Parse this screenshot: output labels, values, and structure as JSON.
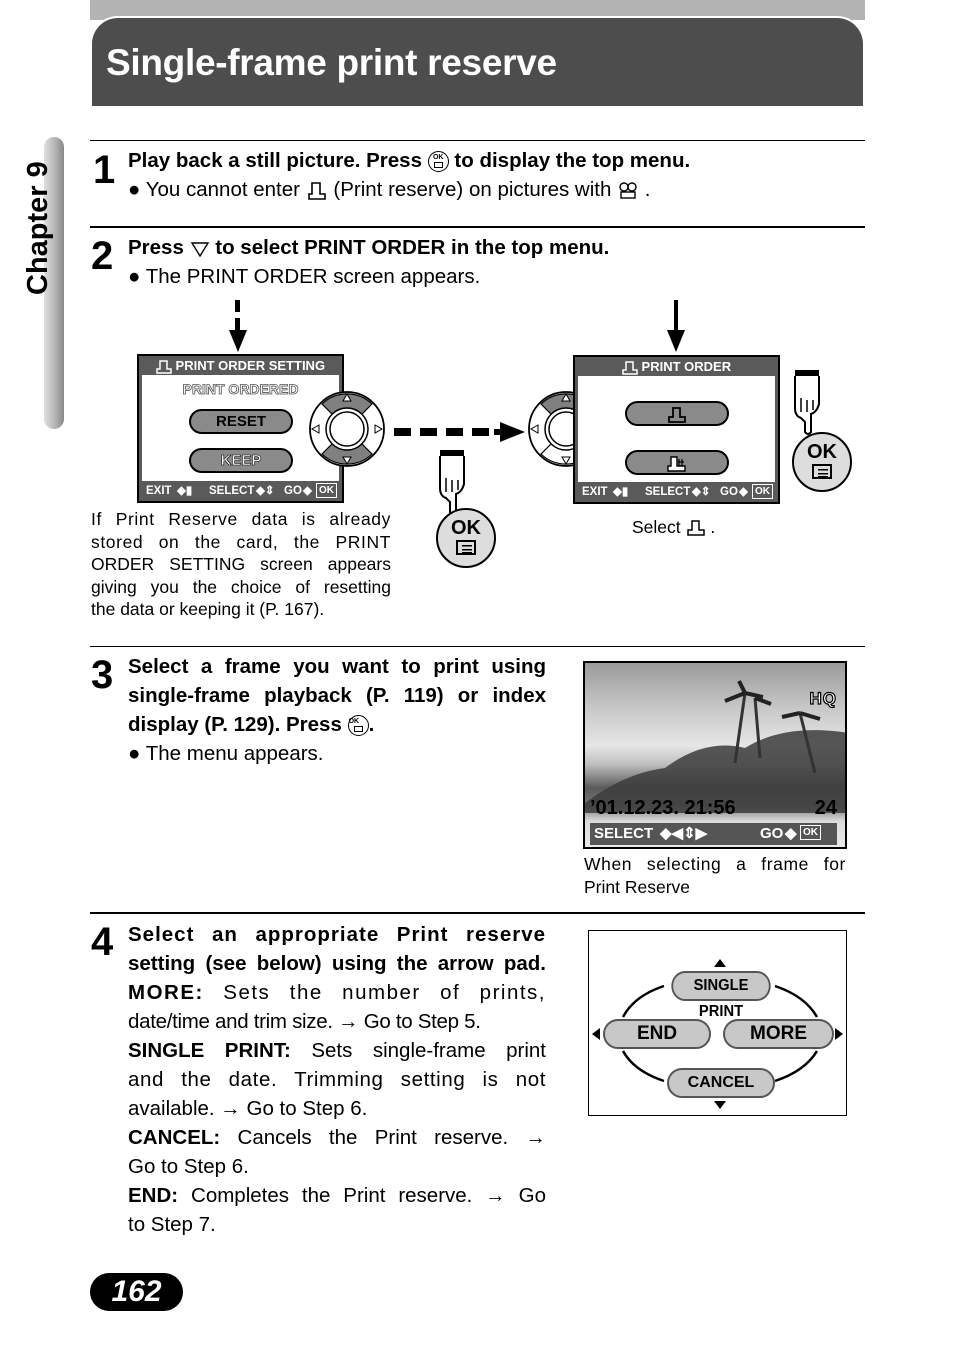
{
  "page": {
    "title": "Single-frame print reserve",
    "chapter": "Chapter 9",
    "page_number": "162"
  },
  "steps": [
    {
      "number": "1",
      "heading_a": "Play back a still picture. Press",
      "heading_icon": "ok-menu-button-icon",
      "heading_b": "to display the top menu.",
      "bullet_a": "You cannot enter",
      "bullet_icon1": "print-reserve-icon",
      "bullet_b": "(Print reserve) on pictures with",
      "bullet_icon2": "movie-icon",
      "bullet_c": "."
    },
    {
      "number": "2",
      "heading_a": "Press",
      "heading_icon": "down-arrow-icon",
      "heading_b": "to select PRINT ORDER in the top menu.",
      "bullet": "The PRINT ORDER screen appears."
    },
    {
      "number": "3",
      "heading_lines": [
        "Select a frame you want to print using",
        "single-frame playback (P. 119) or index",
        "display (P. 129). Press"
      ],
      "heading_end": ".",
      "bullet": "The menu appears."
    },
    {
      "number": "4",
      "heading_lines": [
        "Select an appropriate Print reserve",
        "setting (see below) using the arrow pad."
      ],
      "options": [
        {
          "term": "MORE:",
          "lines": [
            "Sets the number of prints,",
            "date/time and trim size. → Go to Step 5."
          ]
        },
        {
          "term": "SINGLE PRINT:",
          "lines": [
            "Sets single-frame print",
            "and the date. Trimming setting is not",
            "available. → Go to Step 6."
          ]
        },
        {
          "term": "CANCEL:",
          "lines": [
            "Cancels the Print reserve. →",
            "Go to Step 6."
          ]
        },
        {
          "term": "END:",
          "lines": [
            "Completes the Print reserve. → Go",
            "to Step 7."
          ]
        }
      ]
    }
  ],
  "screen_print_order_setting": {
    "title": "PRINT ORDER SETTING",
    "subtitle": "PRINT ORDERED",
    "buttons": [
      "RESET",
      "KEEP"
    ],
    "footer": {
      "exit": "EXIT",
      "select": "SELECT",
      "go": "GO",
      "ok": "OK"
    }
  },
  "screen_print_order": {
    "title": "PRINT ORDER",
    "options": [
      "single-print-icon",
      "all-print-icon"
    ],
    "footer": {
      "exit": "EXIT",
      "select": "SELECT",
      "go": "GO",
      "ok": "OK"
    }
  },
  "ok_button_label": "OK",
  "captions": {
    "print_reserve_note": [
      "If Print Reserve data is already",
      "stored on the card, the PRINT",
      "ORDER SETTING screen appears",
      "giving you the choice of resetting",
      "the data or keeping it (P. 167)."
    ],
    "select_a": "Select",
    "select_b": ".",
    "frame_select": [
      "When selecting a frame for",
      "Print Reserve"
    ]
  },
  "playback_screen": {
    "quality": "HQ",
    "datetime": "’01.12.23. 21:56",
    "frame_count": "24",
    "select": "SELECT",
    "go": "GO",
    "ok": "OK"
  },
  "menu_diagram": {
    "up": "SINGLE PRINT",
    "left": "END",
    "right": "MORE",
    "down": "CANCEL"
  }
}
